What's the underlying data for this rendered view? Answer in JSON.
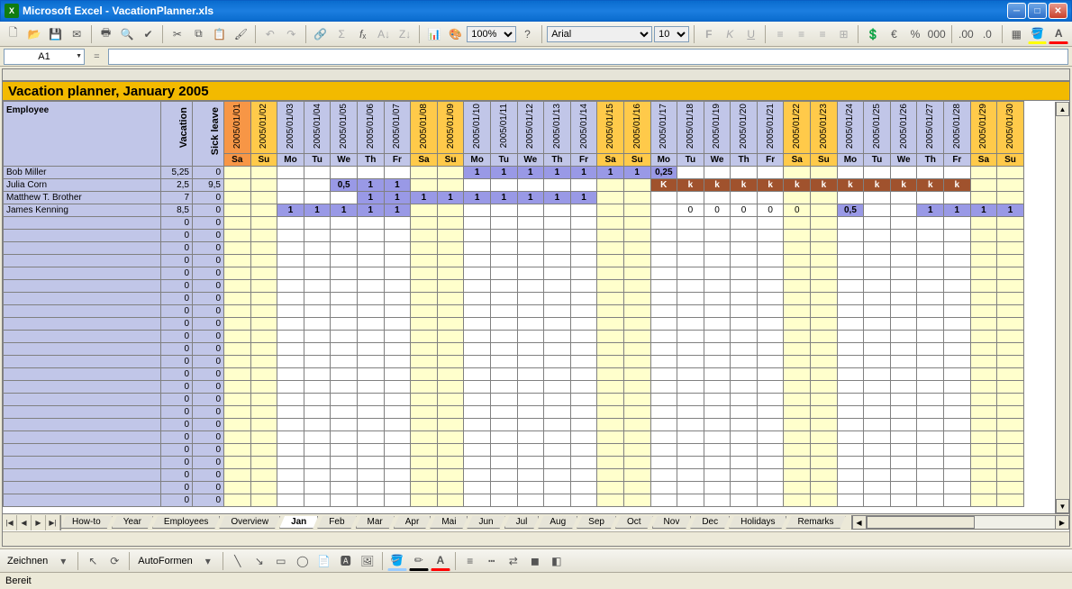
{
  "window": {
    "app_name": "Microsoft Excel",
    "file_name": "VacationPlanner.xls",
    "title": "Microsoft Excel - VacationPlanner.xls"
  },
  "toolbar": {
    "font_family": "Arial",
    "font_size": "10",
    "zoom": "100%"
  },
  "namebox": {
    "ref": "A1",
    "formula": ""
  },
  "sheet": {
    "title": "Vacation planner, January 2005",
    "employee_header": "Employee",
    "vacation_header": "Vacation",
    "sick_header": "Sick leave",
    "days": [
      {
        "date": "2005/01/01",
        "dow": "Sa",
        "weekend": true,
        "special": true
      },
      {
        "date": "2005/01/02",
        "dow": "Su",
        "weekend": true
      },
      {
        "date": "2005/01/03",
        "dow": "Mo"
      },
      {
        "date": "2005/01/04",
        "dow": "Tu"
      },
      {
        "date": "2005/01/05",
        "dow": "We"
      },
      {
        "date": "2005/01/06",
        "dow": "Th"
      },
      {
        "date": "2005/01/07",
        "dow": "Fr"
      },
      {
        "date": "2005/01/08",
        "dow": "Sa",
        "weekend": true
      },
      {
        "date": "2005/01/09",
        "dow": "Su",
        "weekend": true
      },
      {
        "date": "2005/01/10",
        "dow": "Mo"
      },
      {
        "date": "2005/01/11",
        "dow": "Tu"
      },
      {
        "date": "2005/01/12",
        "dow": "We"
      },
      {
        "date": "2005/01/13",
        "dow": "Th"
      },
      {
        "date": "2005/01/14",
        "dow": "Fr"
      },
      {
        "date": "2005/01/15",
        "dow": "Sa",
        "weekend": true
      },
      {
        "date": "2005/01/16",
        "dow": "Su",
        "weekend": true
      },
      {
        "date": "2005/01/17",
        "dow": "Mo"
      },
      {
        "date": "2005/01/18",
        "dow": "Tu"
      },
      {
        "date": "2005/01/19",
        "dow": "We"
      },
      {
        "date": "2005/01/20",
        "dow": "Th"
      },
      {
        "date": "2005/01/21",
        "dow": "Fr"
      },
      {
        "date": "2005/01/22",
        "dow": "Sa",
        "weekend": true
      },
      {
        "date": "2005/01/23",
        "dow": "Su",
        "weekend": true
      },
      {
        "date": "2005/01/24",
        "dow": "Mo"
      },
      {
        "date": "2005/01/25",
        "dow": "Tu"
      },
      {
        "date": "2005/01/26",
        "dow": "We"
      },
      {
        "date": "2005/01/27",
        "dow": "Th"
      },
      {
        "date": "2005/01/28",
        "dow": "Fr"
      },
      {
        "date": "2005/01/29",
        "dow": "Sa",
        "weekend": true
      },
      {
        "date": "2005/01/30",
        "dow": "Su",
        "weekend": true
      }
    ],
    "rows": [
      {
        "name": "Bob Miller",
        "vac": "5,25",
        "sick": "0",
        "cells": {
          "10": {
            "v": "1",
            "t": "vac"
          },
          "11": {
            "v": "1",
            "t": "vac"
          },
          "12": {
            "v": "1",
            "t": "vac"
          },
          "13": {
            "v": "1",
            "t": "vac"
          },
          "14": {
            "v": "1",
            "t": "vac"
          },
          "15": {
            "v": "1",
            "t": "vac"
          },
          "16": {
            "v": "1",
            "t": "vac"
          },
          "17": {
            "v": "0,25",
            "t": "vac"
          }
        }
      },
      {
        "name": "Julia Corn",
        "vac": "2,5",
        "sick": "9,5",
        "cells": {
          "5": {
            "v": "0,5",
            "t": "vac"
          },
          "6": {
            "v": "1",
            "t": "vac"
          },
          "7": {
            "v": "1",
            "t": "vac"
          },
          "17": {
            "v": "K",
            "t": "sick"
          },
          "18": {
            "v": "k",
            "t": "sick"
          },
          "19": {
            "v": "k",
            "t": "sick"
          },
          "20": {
            "v": "k",
            "t": "sick"
          },
          "21": {
            "v": "k",
            "t": "sick"
          },
          "22": {
            "v": "k",
            "t": "sick"
          },
          "23": {
            "v": "k",
            "t": "sick"
          },
          "24": {
            "v": "k",
            "t": "sick"
          },
          "25": {
            "v": "k",
            "t": "sick"
          },
          "26": {
            "v": "k",
            "t": "sick"
          },
          "27": {
            "v": "k",
            "t": "sick"
          },
          "28": {
            "v": "k",
            "t": "sick"
          }
        }
      },
      {
        "name": "Matthew T. Brother",
        "vac": "7",
        "sick": "0",
        "cells": {
          "6": {
            "v": "1",
            "t": "vac"
          },
          "7": {
            "v": "1",
            "t": "vac"
          },
          "8": {
            "v": "1",
            "t": "vac"
          },
          "9": {
            "v": "1",
            "t": "vac"
          },
          "10": {
            "v": "1",
            "t": "vac"
          },
          "11": {
            "v": "1",
            "t": "vac"
          },
          "12": {
            "v": "1",
            "t": "vac"
          },
          "13": {
            "v": "1",
            "t": "vac"
          },
          "14": {
            "v": "1",
            "t": "vac"
          }
        }
      },
      {
        "name": "James Kenning",
        "vac": "8,5",
        "sick": "0",
        "cells": {
          "3": {
            "v": "1",
            "t": "vac"
          },
          "4": {
            "v": "1",
            "t": "vac"
          },
          "5": {
            "v": "1",
            "t": "vac"
          },
          "6": {
            "v": "1",
            "t": "vac"
          },
          "7": {
            "v": "1",
            "t": "vac"
          },
          "18": {
            "v": "0"
          },
          "19": {
            "v": "0"
          },
          "20": {
            "v": "0"
          },
          "21": {
            "v": "0"
          },
          "22": {
            "v": "0"
          },
          "24": {
            "v": "0,5",
            "t": "vac"
          },
          "27": {
            "v": "1",
            "t": "vac"
          },
          "28": {
            "v": "1",
            "t": "vac"
          },
          "29": {
            "v": "1",
            "t": "vac"
          },
          "30": {
            "v": "1",
            "t": "vac"
          }
        }
      },
      {
        "name": "",
        "vac": "0",
        "sick": "0",
        "cells": {}
      },
      {
        "name": "",
        "vac": "0",
        "sick": "0",
        "cells": {}
      },
      {
        "name": "",
        "vac": "0",
        "sick": "0",
        "cells": {}
      },
      {
        "name": "",
        "vac": "0",
        "sick": "0",
        "cells": {}
      },
      {
        "name": "",
        "vac": "0",
        "sick": "0",
        "cells": {}
      },
      {
        "name": "",
        "vac": "0",
        "sick": "0",
        "cells": {}
      },
      {
        "name": "",
        "vac": "0",
        "sick": "0",
        "cells": {}
      },
      {
        "name": "",
        "vac": "0",
        "sick": "0",
        "cells": {}
      },
      {
        "name": "",
        "vac": "0",
        "sick": "0",
        "cells": {}
      },
      {
        "name": "",
        "vac": "0",
        "sick": "0",
        "cells": {}
      },
      {
        "name": "",
        "vac": "0",
        "sick": "0",
        "cells": {}
      },
      {
        "name": "",
        "vac": "0",
        "sick": "0",
        "cells": {}
      },
      {
        "name": "",
        "vac": "0",
        "sick": "0",
        "cells": {}
      },
      {
        "name": "",
        "vac": "0",
        "sick": "0",
        "cells": {}
      },
      {
        "name": "",
        "vac": "0",
        "sick": "0",
        "cells": {}
      },
      {
        "name": "",
        "vac": "0",
        "sick": "0",
        "cells": {}
      },
      {
        "name": "",
        "vac": "0",
        "sick": "0",
        "cells": {}
      },
      {
        "name": "",
        "vac": "0",
        "sick": "0",
        "cells": {}
      },
      {
        "name": "",
        "vac": "0",
        "sick": "0",
        "cells": {}
      },
      {
        "name": "",
        "vac": "0",
        "sick": "0",
        "cells": {}
      },
      {
        "name": "",
        "vac": "0",
        "sick": "0",
        "cells": {}
      },
      {
        "name": "",
        "vac": "0",
        "sick": "0",
        "cells": {}
      },
      {
        "name": "",
        "vac": "0",
        "sick": "0",
        "cells": {}
      }
    ]
  },
  "tabs": [
    "How-to",
    "Year",
    "Employees",
    "Overview",
    "Jan",
    "Feb",
    "Mar",
    "Apr",
    "Mai",
    "Jun",
    "Jul",
    "Aug",
    "Sep",
    "Oct",
    "Nov",
    "Dec",
    "Holidays",
    "Remarks"
  ],
  "active_tab": "Jan",
  "drawing": {
    "label": "Zeichnen",
    "autoshapes": "AutoFormen"
  },
  "status": {
    "text": "Bereit"
  }
}
